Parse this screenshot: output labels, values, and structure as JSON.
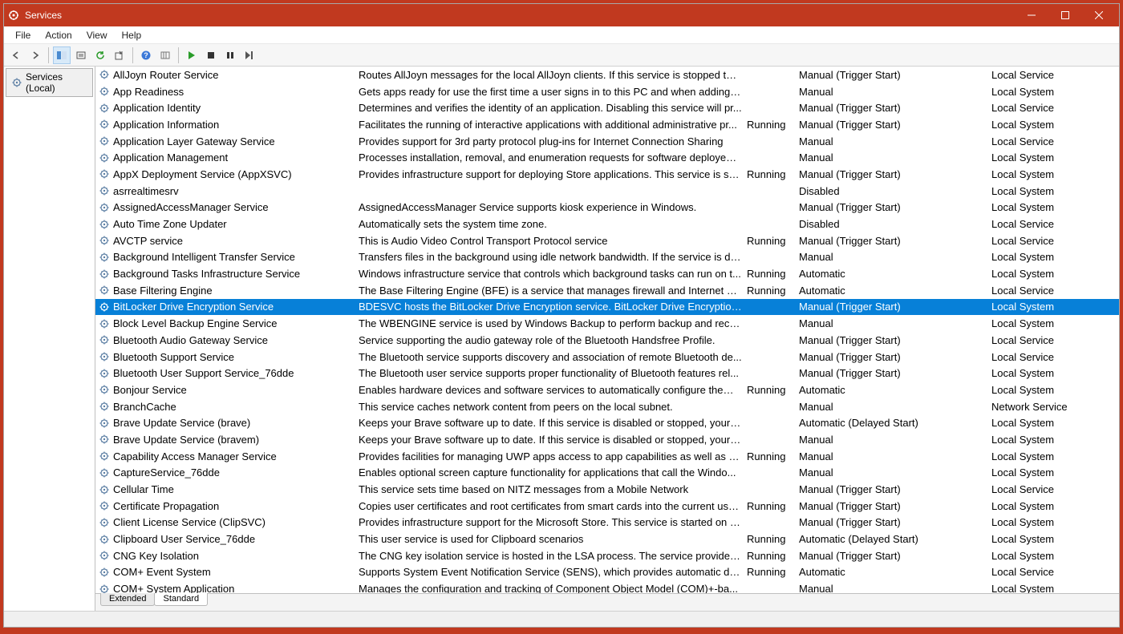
{
  "titlebar": {
    "title": "Services"
  },
  "menubar": {
    "items": [
      "File",
      "Action",
      "View",
      "Help"
    ]
  },
  "toolbar": {
    "icons": [
      "back-icon",
      "forward-icon",
      "up-icon",
      "show-hide-icon",
      "refresh-icon",
      "export-icon",
      "help-icon",
      "properties-icon",
      "start-icon",
      "stop-icon",
      "pause-icon",
      "restart-icon"
    ]
  },
  "tree": {
    "root": "Services (Local)"
  },
  "columns": [
    "Name",
    "Description",
    "Status",
    "Startup Type",
    "Log On As"
  ],
  "tabs": {
    "extended": "Extended",
    "standard": "Standard"
  },
  "selectedIndex": 13,
  "services": [
    {
      "name": "AllJoyn Router Service",
      "desc": "Routes AllJoyn messages for the local AllJoyn clients. If this service is stopped the ...",
      "status": "",
      "startup": "Manual (Trigger Start)",
      "logon": "Local Service"
    },
    {
      "name": "App Readiness",
      "desc": "Gets apps ready for use the first time a user signs in to this PC and when adding n...",
      "status": "",
      "startup": "Manual",
      "logon": "Local System"
    },
    {
      "name": "Application Identity",
      "desc": "Determines and verifies the identity of an application. Disabling this service will pr...",
      "status": "",
      "startup": "Manual (Trigger Start)",
      "logon": "Local Service"
    },
    {
      "name": "Application Information",
      "desc": "Facilitates the running of interactive applications with additional administrative pr...",
      "status": "Running",
      "startup": "Manual (Trigger Start)",
      "logon": "Local System"
    },
    {
      "name": "Application Layer Gateway Service",
      "desc": "Provides support for 3rd party protocol plug-ins for Internet Connection Sharing",
      "status": "",
      "startup": "Manual",
      "logon": "Local Service"
    },
    {
      "name": "Application Management",
      "desc": "Processes installation, removal, and enumeration requests for software deployed t...",
      "status": "",
      "startup": "Manual",
      "logon": "Local System"
    },
    {
      "name": "AppX Deployment Service (AppXSVC)",
      "desc": "Provides infrastructure support for deploying Store applications. This service is sta...",
      "status": "Running",
      "startup": "Manual (Trigger Start)",
      "logon": "Local System"
    },
    {
      "name": "asrrealtimesrv",
      "desc": "",
      "status": "",
      "startup": "Disabled",
      "logon": "Local System"
    },
    {
      "name": "AssignedAccessManager Service",
      "desc": "AssignedAccessManager Service supports kiosk experience in Windows.",
      "status": "",
      "startup": "Manual (Trigger Start)",
      "logon": "Local System"
    },
    {
      "name": "Auto Time Zone Updater",
      "desc": "Automatically sets the system time zone.",
      "status": "",
      "startup": "Disabled",
      "logon": "Local Service"
    },
    {
      "name": "AVCTP service",
      "desc": "This is Audio Video Control Transport Protocol service",
      "status": "Running",
      "startup": "Manual (Trigger Start)",
      "logon": "Local Service"
    },
    {
      "name": "Background Intelligent Transfer Service",
      "desc": "Transfers files in the background using idle network bandwidth. If the service is dis...",
      "status": "",
      "startup": "Manual",
      "logon": "Local System"
    },
    {
      "name": "Background Tasks Infrastructure Service",
      "desc": "Windows infrastructure service that controls which background tasks can run on t...",
      "status": "Running",
      "startup": "Automatic",
      "logon": "Local System"
    },
    {
      "name": "Base Filtering Engine",
      "desc": "The Base Filtering Engine (BFE) is a service that manages firewall and Internet Prot...",
      "status": "Running",
      "startup": "Automatic",
      "logon": "Local Service"
    },
    {
      "name": "BitLocker Drive Encryption Service",
      "desc": "BDESVC hosts the BitLocker Drive Encryption service. BitLocker Drive Encryption pr...",
      "status": "",
      "startup": "Manual (Trigger Start)",
      "logon": "Local System"
    },
    {
      "name": "Block Level Backup Engine Service",
      "desc": "The WBENGINE service is used by Windows Backup to perform backup and recove...",
      "status": "",
      "startup": "Manual",
      "logon": "Local System"
    },
    {
      "name": "Bluetooth Audio Gateway Service",
      "desc": "Service supporting the audio gateway role of the Bluetooth Handsfree Profile.",
      "status": "",
      "startup": "Manual (Trigger Start)",
      "logon": "Local Service"
    },
    {
      "name": "Bluetooth Support Service",
      "desc": "The Bluetooth service supports discovery and association of remote Bluetooth de...",
      "status": "",
      "startup": "Manual (Trigger Start)",
      "logon": "Local Service"
    },
    {
      "name": "Bluetooth User Support Service_76dde",
      "desc": "The Bluetooth user service supports proper functionality of Bluetooth features rel...",
      "status": "",
      "startup": "Manual (Trigger Start)",
      "logon": "Local System"
    },
    {
      "name": "Bonjour Service",
      "desc": "Enables hardware devices and software services to automatically configure themse...",
      "status": "Running",
      "startup": "Automatic",
      "logon": "Local System"
    },
    {
      "name": "BranchCache",
      "desc": "This service caches network content from peers on the local subnet.",
      "status": "",
      "startup": "Manual",
      "logon": "Network Service"
    },
    {
      "name": "Brave Update Service (brave)",
      "desc": "Keeps your Brave software up to date. If this service is disabled or stopped, your B...",
      "status": "",
      "startup": "Automatic (Delayed Start)",
      "logon": "Local System"
    },
    {
      "name": "Brave Update Service (bravem)",
      "desc": "Keeps your Brave software up to date. If this service is disabled or stopped, your B...",
      "status": "",
      "startup": "Manual",
      "logon": "Local System"
    },
    {
      "name": "Capability Access Manager Service",
      "desc": "Provides facilities for managing UWP apps access to app capabilities as well as che...",
      "status": "Running",
      "startup": "Manual",
      "logon": "Local System"
    },
    {
      "name": "CaptureService_76dde",
      "desc": "Enables optional screen capture functionality for applications that call the Windo...",
      "status": "",
      "startup": "Manual",
      "logon": "Local System"
    },
    {
      "name": "Cellular Time",
      "desc": "This service sets time based on NITZ messages from a Mobile Network",
      "status": "",
      "startup": "Manual (Trigger Start)",
      "logon": "Local Service"
    },
    {
      "name": "Certificate Propagation",
      "desc": "Copies user certificates and root certificates from smart cards into the current user'...",
      "status": "Running",
      "startup": "Manual (Trigger Start)",
      "logon": "Local System"
    },
    {
      "name": "Client License Service (ClipSVC)",
      "desc": "Provides infrastructure support for the Microsoft Store. This service is started on d...",
      "status": "",
      "startup": "Manual (Trigger Start)",
      "logon": "Local System"
    },
    {
      "name": "Clipboard User Service_76dde",
      "desc": "This user service is used for Clipboard scenarios",
      "status": "Running",
      "startup": "Automatic (Delayed Start)",
      "logon": "Local System"
    },
    {
      "name": "CNG Key Isolation",
      "desc": "The CNG key isolation service is hosted in the LSA process. The service provides ke...",
      "status": "Running",
      "startup": "Manual (Trigger Start)",
      "logon": "Local System"
    },
    {
      "name": "COM+ Event System",
      "desc": "Supports System Event Notification Service (SENS), which provides automatic distri...",
      "status": "Running",
      "startup": "Automatic",
      "logon": "Local Service"
    },
    {
      "name": "COM+ System Application",
      "desc": "Manages the configuration and tracking of Component Object Model (COM)+-ba...",
      "status": "",
      "startup": "Manual",
      "logon": "Local System"
    }
  ]
}
